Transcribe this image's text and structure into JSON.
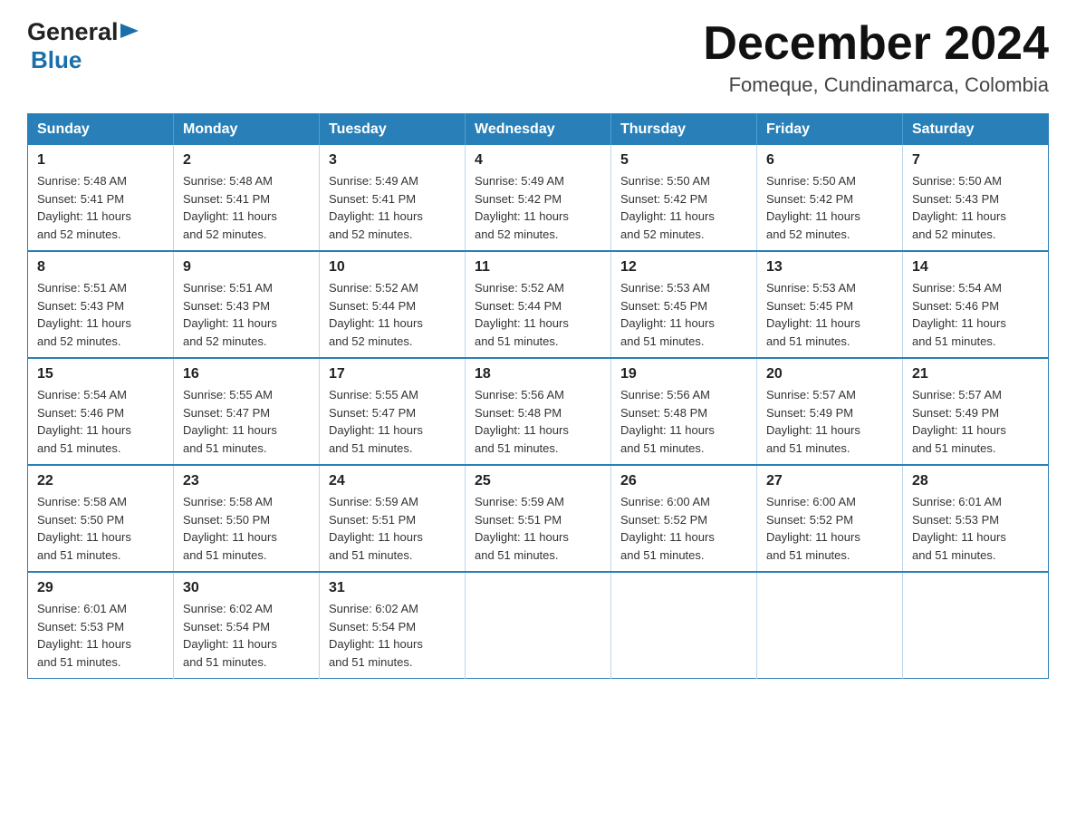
{
  "logo": {
    "general": "General",
    "blue": "Blue"
  },
  "title": "December 2024",
  "subtitle": "Fomeque, Cundinamarca, Colombia",
  "days_header": [
    "Sunday",
    "Monday",
    "Tuesday",
    "Wednesday",
    "Thursday",
    "Friday",
    "Saturday"
  ],
  "weeks": [
    [
      {
        "num": "1",
        "sunrise": "5:48 AM",
        "sunset": "5:41 PM",
        "daylight": "11 hours and 52 minutes."
      },
      {
        "num": "2",
        "sunrise": "5:48 AM",
        "sunset": "5:41 PM",
        "daylight": "11 hours and 52 minutes."
      },
      {
        "num": "3",
        "sunrise": "5:49 AM",
        "sunset": "5:41 PM",
        "daylight": "11 hours and 52 minutes."
      },
      {
        "num": "4",
        "sunrise": "5:49 AM",
        "sunset": "5:42 PM",
        "daylight": "11 hours and 52 minutes."
      },
      {
        "num": "5",
        "sunrise": "5:50 AM",
        "sunset": "5:42 PM",
        "daylight": "11 hours and 52 minutes."
      },
      {
        "num": "6",
        "sunrise": "5:50 AM",
        "sunset": "5:42 PM",
        "daylight": "11 hours and 52 minutes."
      },
      {
        "num": "7",
        "sunrise": "5:50 AM",
        "sunset": "5:43 PM",
        "daylight": "11 hours and 52 minutes."
      }
    ],
    [
      {
        "num": "8",
        "sunrise": "5:51 AM",
        "sunset": "5:43 PM",
        "daylight": "11 hours and 52 minutes."
      },
      {
        "num": "9",
        "sunrise": "5:51 AM",
        "sunset": "5:43 PM",
        "daylight": "11 hours and 52 minutes."
      },
      {
        "num": "10",
        "sunrise": "5:52 AM",
        "sunset": "5:44 PM",
        "daylight": "11 hours and 52 minutes."
      },
      {
        "num": "11",
        "sunrise": "5:52 AM",
        "sunset": "5:44 PM",
        "daylight": "11 hours and 51 minutes."
      },
      {
        "num": "12",
        "sunrise": "5:53 AM",
        "sunset": "5:45 PM",
        "daylight": "11 hours and 51 minutes."
      },
      {
        "num": "13",
        "sunrise": "5:53 AM",
        "sunset": "5:45 PM",
        "daylight": "11 hours and 51 minutes."
      },
      {
        "num": "14",
        "sunrise": "5:54 AM",
        "sunset": "5:46 PM",
        "daylight": "11 hours and 51 minutes."
      }
    ],
    [
      {
        "num": "15",
        "sunrise": "5:54 AM",
        "sunset": "5:46 PM",
        "daylight": "11 hours and 51 minutes."
      },
      {
        "num": "16",
        "sunrise": "5:55 AM",
        "sunset": "5:47 PM",
        "daylight": "11 hours and 51 minutes."
      },
      {
        "num": "17",
        "sunrise": "5:55 AM",
        "sunset": "5:47 PM",
        "daylight": "11 hours and 51 minutes."
      },
      {
        "num": "18",
        "sunrise": "5:56 AM",
        "sunset": "5:48 PM",
        "daylight": "11 hours and 51 minutes."
      },
      {
        "num": "19",
        "sunrise": "5:56 AM",
        "sunset": "5:48 PM",
        "daylight": "11 hours and 51 minutes."
      },
      {
        "num": "20",
        "sunrise": "5:57 AM",
        "sunset": "5:49 PM",
        "daylight": "11 hours and 51 minutes."
      },
      {
        "num": "21",
        "sunrise": "5:57 AM",
        "sunset": "5:49 PM",
        "daylight": "11 hours and 51 minutes."
      }
    ],
    [
      {
        "num": "22",
        "sunrise": "5:58 AM",
        "sunset": "5:50 PM",
        "daylight": "11 hours and 51 minutes."
      },
      {
        "num": "23",
        "sunrise": "5:58 AM",
        "sunset": "5:50 PM",
        "daylight": "11 hours and 51 minutes."
      },
      {
        "num": "24",
        "sunrise": "5:59 AM",
        "sunset": "5:51 PM",
        "daylight": "11 hours and 51 minutes."
      },
      {
        "num": "25",
        "sunrise": "5:59 AM",
        "sunset": "5:51 PM",
        "daylight": "11 hours and 51 minutes."
      },
      {
        "num": "26",
        "sunrise": "6:00 AM",
        "sunset": "5:52 PM",
        "daylight": "11 hours and 51 minutes."
      },
      {
        "num": "27",
        "sunrise": "6:00 AM",
        "sunset": "5:52 PM",
        "daylight": "11 hours and 51 minutes."
      },
      {
        "num": "28",
        "sunrise": "6:01 AM",
        "sunset": "5:53 PM",
        "daylight": "11 hours and 51 minutes."
      }
    ],
    [
      {
        "num": "29",
        "sunrise": "6:01 AM",
        "sunset": "5:53 PM",
        "daylight": "11 hours and 51 minutes."
      },
      {
        "num": "30",
        "sunrise": "6:02 AM",
        "sunset": "5:54 PM",
        "daylight": "11 hours and 51 minutes."
      },
      {
        "num": "31",
        "sunrise": "6:02 AM",
        "sunset": "5:54 PM",
        "daylight": "11 hours and 51 minutes."
      },
      null,
      null,
      null,
      null
    ]
  ],
  "labels": {
    "sunrise": "Sunrise:",
    "sunset": "Sunset:",
    "daylight": "Daylight:"
  }
}
